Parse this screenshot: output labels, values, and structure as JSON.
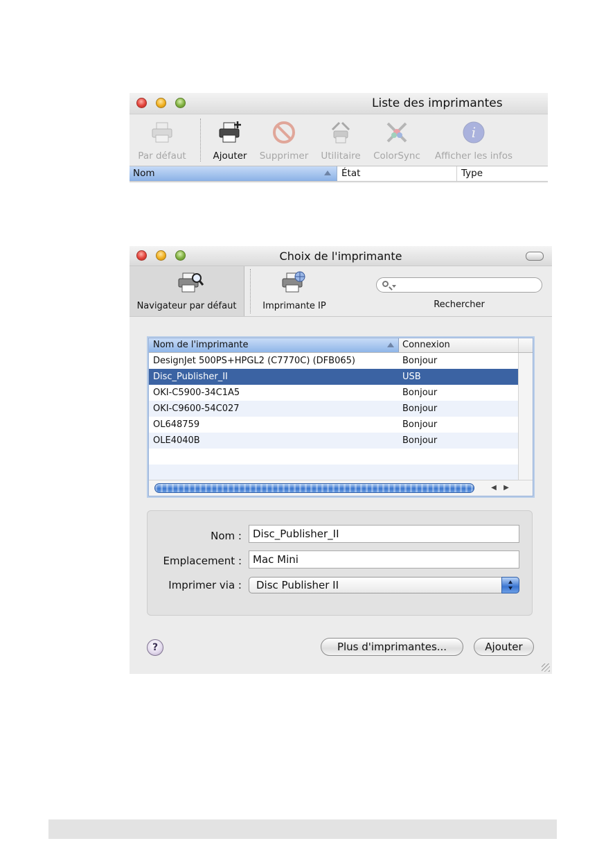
{
  "window1": {
    "title": "Liste des imprimantes",
    "toolbar": [
      {
        "label": "Par défaut",
        "icon": "printer-default-icon",
        "enabled": false
      },
      {
        "label": "Ajouter",
        "icon": "printer-add-icon",
        "enabled": true
      },
      {
        "label": "Supprimer",
        "icon": "delete-icon",
        "enabled": false
      },
      {
        "label": "Utilitaire",
        "icon": "utility-tools-icon",
        "enabled": false
      },
      {
        "label": "ColorSync",
        "icon": "colorsync-icon",
        "enabled": false
      },
      {
        "label": "Afficher les infos",
        "icon": "info-icon",
        "enabled": false
      }
    ],
    "columns": [
      "Nom",
      "État",
      "Type"
    ]
  },
  "window2": {
    "title": "Choix de l'imprimante",
    "toolbar": {
      "default_browser": "Navigateur par défaut",
      "ip_printer": "Imprimante IP",
      "search_placeholder": "",
      "search_label": "Rechercher"
    },
    "list": {
      "headers": [
        "Nom de l'imprimante",
        "Connexion"
      ],
      "rows": [
        {
          "name": "DesignJet 500PS+HPGL2 (C7770C) (DFB065)",
          "connection": "Bonjour"
        },
        {
          "name": "Disc_Publisher_II",
          "connection": "USB",
          "selected": true
        },
        {
          "name": "OKI-C5900-34C1A5",
          "connection": "Bonjour"
        },
        {
          "name": "OKI-C9600-54C027",
          "connection": "Bonjour"
        },
        {
          "name": "OL648759",
          "connection": "Bonjour"
        },
        {
          "name": "OLE4040B",
          "connection": "Bonjour"
        }
      ]
    },
    "form": {
      "name_label": "Nom :",
      "name_value": "Disc_Publisher_II",
      "location_label": "Emplacement :",
      "location_value": "Mac Mini",
      "print_via_label": "Imprimer via :",
      "print_via_value": "Disc Publisher II"
    },
    "buttons": {
      "help": "?",
      "more_printers": "Plus d'imprimantes...",
      "add": "Ajouter"
    }
  },
  "colors": {
    "selection": "#3b63a3",
    "header_selected": "#8fb5e8",
    "window_bg": "#ececec"
  }
}
